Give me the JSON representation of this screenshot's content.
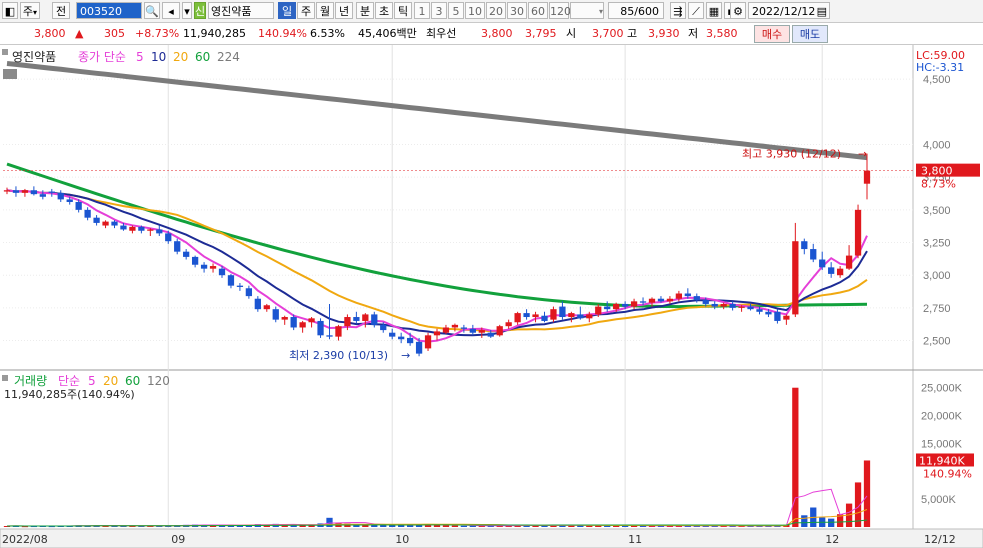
{
  "toolbar": {
    "market": "주",
    "market_arrow": "▾",
    "prev_label": "전",
    "stock_code": "003520",
    "stock_badge": "신",
    "stock_name": "영진약품",
    "periods": [
      "일",
      "주",
      "월",
      "년",
      "분",
      "초",
      "틱"
    ],
    "selected_period": "일",
    "intervals": [
      "1",
      "3",
      "5",
      "10",
      "20",
      "30",
      "60",
      "120"
    ],
    "count": "85/600",
    "date": "2022/12/12"
  },
  "quote": {
    "price": "3,800",
    "arrow": "▲",
    "change": "305",
    "change_pct": "+8.73%",
    "volume": "11,940,285",
    "volume_ratio": "140.94%",
    "turnover": "6.53%",
    "amount": "45,406백만",
    "bid_label": "최우선",
    "ask": "3,800",
    "bid": "3,795",
    "open_label": "시",
    "open": "3,700",
    "high_label": "고",
    "high": "3,930",
    "low_label": "저",
    "low": "3,580",
    "buy_label": "매수",
    "sell_label": "매도"
  },
  "colors": {
    "up": "#e0181d",
    "down": "#1b55d1",
    "ma5": "#e53fd8",
    "ma10": "#1d2b95",
    "ma20": "#f0a810",
    "ma60": "#12a13c",
    "ma224": "#7b7b7b"
  },
  "chart_data": {
    "type": "candlestick",
    "price_panel": {
      "stock_label": "영진약품",
      "legend_prefix": "종가 단순",
      "legend": [
        {
          "name": "5",
          "color": "#e53fd8"
        },
        {
          "name": "10",
          "color": "#1d2b95"
        },
        {
          "name": "20",
          "color": "#f0a810"
        },
        {
          "name": "60",
          "color": "#12a13c"
        },
        {
          "name": "224",
          "color": "#7b7b7b"
        }
      ],
      "lc": "LC:59.00",
      "hc": "HC:-3.31",
      "y_ticks": [
        "4,500",
        "4,000",
        "3,750",
        "3,500",
        "3,250",
        "3,000",
        "2,750",
        "2,500"
      ],
      "y_tick_values": [
        4500,
        4000,
        3750,
        3500,
        3250,
        3000,
        2750,
        2500
      ],
      "ylim": [
        2290,
        4700
      ],
      "current_price": "3,800",
      "current_pct": "8.73%",
      "max_annotation": "최고 3,930 (12/12)",
      "min_annotation": "최저 2,390 (10/13)"
    },
    "volume_panel": {
      "label": "거래량",
      "legend_prefix": "단순",
      "legend": [
        {
          "name": "5",
          "color": "#e53fd8"
        },
        {
          "name": "20",
          "color": "#f0a810"
        },
        {
          "name": "60",
          "color": "#12a13c"
        },
        {
          "name": "120",
          "color": "#7b7b7b"
        }
      ],
      "volume_text": "11,940,285주(140.94%)",
      "y_ticks": [
        "25,000K",
        "20,000K",
        "15,000K",
        "5,000K"
      ],
      "y_tick_values": [
        25000,
        20000,
        15000,
        5000
      ],
      "ylim": [
        0,
        28000
      ],
      "current_volume": "11,940K",
      "current_pct": "140.94%"
    },
    "x_labels": [
      "2022/08",
      "09",
      "10",
      "11",
      "12",
      "12/12"
    ],
    "x_label_index": [
      0,
      18,
      43,
      69,
      91,
      117
    ],
    "candles": [
      [
        3640,
        3670,
        3620,
        3650,
        180
      ],
      [
        3650,
        3680,
        3600,
        3630,
        210
      ],
      [
        3630,
        3660,
        3600,
        3650,
        150
      ],
      [
        3650,
        3680,
        3610,
        3620,
        170
      ],
      [
        3620,
        3650,
        3580,
        3600,
        200
      ],
      [
        3640,
        3660,
        3600,
        3630,
        160
      ],
      [
        3630,
        3650,
        3560,
        3580,
        190
      ],
      [
        3580,
        3600,
        3540,
        3560,
        220
      ],
      [
        3560,
        3580,
        3480,
        3500,
        300
      ],
      [
        3500,
        3520,
        3420,
        3440,
        280
      ],
      [
        3440,
        3460,
        3380,
        3400,
        310
      ],
      [
        3380,
        3420,
        3360,
        3410,
        220
      ],
      [
        3410,
        3420,
        3360,
        3380,
        240
      ],
      [
        3380,
        3400,
        3340,
        3350,
        250
      ],
      [
        3340,
        3380,
        3320,
        3370,
        200
      ],
      [
        3370,
        3380,
        3320,
        3340,
        210
      ],
      [
        3340,
        3360,
        3300,
        3350,
        190
      ],
      [
        3350,
        3380,
        3300,
        3320,
        230
      ],
      [
        3320,
        3340,
        3240,
        3260,
        280
      ],
      [
        3260,
        3280,
        3160,
        3180,
        350
      ],
      [
        3180,
        3200,
        3120,
        3140,
        380
      ],
      [
        3140,
        3150,
        3060,
        3080,
        420
      ],
      [
        3080,
        3100,
        3020,
        3050,
        360
      ],
      [
        3050,
        3090,
        3020,
        3070,
        300
      ],
      [
        3050,
        3070,
        2980,
        3000,
        340
      ],
      [
        3000,
        3010,
        2900,
        2920,
        400
      ],
      [
        2920,
        2940,
        2880,
        2910,
        330
      ],
      [
        2900,
        2920,
        2820,
        2840,
        420
      ],
      [
        2820,
        2840,
        2720,
        2740,
        520
      ],
      [
        2740,
        2780,
        2720,
        2770,
        380
      ],
      [
        2740,
        2760,
        2640,
        2660,
        560
      ],
      [
        2660,
        2690,
        2620,
        2680,
        350
      ],
      [
        2680,
        2700,
        2580,
        2600,
        520
      ],
      [
        2600,
        2650,
        2560,
        2640,
        380
      ],
      [
        2640,
        2680,
        2600,
        2670,
        300
      ],
      [
        2650,
        2670,
        2520,
        2540,
        640
      ],
      [
        2540,
        2780,
        2510,
        2530,
        1650
      ],
      [
        2530,
        2620,
        2500,
        2610,
        750
      ],
      [
        2610,
        2700,
        2580,
        2680,
        620
      ],
      [
        2680,
        2720,
        2630,
        2650,
        400
      ],
      [
        2650,
        2710,
        2600,
        2700,
        500
      ],
      [
        2700,
        2720,
        2600,
        2620,
        420
      ],
      [
        2620,
        2640,
        2560,
        2580,
        380
      ],
      [
        2560,
        2590,
        2510,
        2530,
        300
      ],
      [
        2530,
        2560,
        2480,
        2510,
        280
      ],
      [
        2520,
        2560,
        2460,
        2480,
        320
      ],
      [
        2490,
        2520,
        2380,
        2400,
        480
      ],
      [
        2440,
        2560,
        2420,
        2540,
        520
      ],
      [
        2540,
        2590,
        2500,
        2570,
        380
      ],
      [
        2560,
        2620,
        2550,
        2600,
        300
      ],
      [
        2600,
        2630,
        2570,
        2620,
        250
      ],
      [
        2600,
        2620,
        2560,
        2590,
        220
      ],
      [
        2590,
        2620,
        2540,
        2560,
        240
      ],
      [
        2560,
        2600,
        2520,
        2580,
        200
      ],
      [
        2560,
        2580,
        2520,
        2530,
        230
      ],
      [
        2540,
        2620,
        2530,
        2610,
        260
      ],
      [
        2610,
        2660,
        2590,
        2640,
        280
      ],
      [
        2640,
        2720,
        2620,
        2710,
        320
      ],
      [
        2710,
        2740,
        2660,
        2680,
        260
      ],
      [
        2680,
        2720,
        2640,
        2700,
        220
      ],
      [
        2690,
        2720,
        2640,
        2650,
        240
      ],
      [
        2660,
        2760,
        2640,
        2740,
        340
      ],
      [
        2760,
        2800,
        2660,
        2680,
        380
      ],
      [
        2680,
        2720,
        2640,
        2710,
        260
      ],
      [
        2700,
        2760,
        2660,
        2670,
        280
      ],
      [
        2670,
        2720,
        2640,
        2700,
        240
      ],
      [
        2700,
        2780,
        2680,
        2760,
        330
      ],
      [
        2760,
        2800,
        2720,
        2740,
        280
      ],
      [
        2740,
        2790,
        2720,
        2780,
        250
      ],
      [
        2780,
        2800,
        2740,
        2760,
        230
      ],
      [
        2760,
        2820,
        2740,
        2800,
        260
      ],
      [
        2800,
        2830,
        2770,
        2790,
        210
      ],
      [
        2790,
        2830,
        2760,
        2820,
        230
      ],
      [
        2820,
        2840,
        2790,
        2800,
        200
      ],
      [
        2800,
        2840,
        2780,
        2820,
        210
      ],
      [
        2820,
        2880,
        2800,
        2860,
        250
      ],
      [
        2860,
        2900,
        2820,
        2840,
        230
      ],
      [
        2840,
        2860,
        2790,
        2810,
        200
      ],
      [
        2810,
        2830,
        2760,
        2780,
        230
      ],
      [
        2780,
        2800,
        2740,
        2760,
        210
      ],
      [
        2760,
        2790,
        2740,
        2780,
        190
      ],
      [
        2780,
        2800,
        2730,
        2750,
        200
      ],
      [
        2750,
        2770,
        2720,
        2760,
        180
      ],
      [
        2760,
        2780,
        2730,
        2740,
        190
      ],
      [
        2740,
        2760,
        2700,
        2720,
        220
      ],
      [
        2720,
        2740,
        2680,
        2700,
        200
      ],
      [
        2720,
        2740,
        2630,
        2650,
        350
      ],
      [
        2660,
        2700,
        2620,
        2690,
        380
      ],
      [
        2700,
        3400,
        2680,
        3260,
        25000
      ],
      [
        3260,
        3280,
        3160,
        3200,
        2100
      ],
      [
        3200,
        3240,
        3100,
        3120,
        3500
      ],
      [
        3120,
        3180,
        3040,
        3060,
        1700
      ],
      [
        3060,
        3100,
        2980,
        3010,
        1500
      ],
      [
        3000,
        3070,
        2980,
        3050,
        2300
      ],
      [
        3050,
        3230,
        3040,
        3150,
        4200
      ],
      [
        3150,
        3540,
        3130,
        3500,
        8000
      ],
      [
        3700,
        3930,
        3580,
        3800,
        11940
      ]
    ],
    "ma": {
      "ma5": [
        [
          88,
          2760
        ],
        [
          89,
          2920
        ],
        [
          90,
          3050
        ],
        [
          91,
          3120
        ],
        [
          92,
          3140
        ],
        [
          93,
          3110
        ],
        [
          94,
          3100
        ],
        [
          95,
          3090
        ],
        [
          96,
          3130
        ],
        [
          97,
          3320
        ]
      ],
      "ma10": [
        [
          88,
          2730
        ],
        [
          89,
          2800
        ],
        [
          90,
          2860
        ],
        [
          91,
          2900
        ],
        [
          92,
          2930
        ],
        [
          93,
          2950
        ],
        [
          94,
          2990
        ],
        [
          95,
          3030
        ],
        [
          96,
          3100
        ],
        [
          97,
          3190
        ]
      ],
      "ma20": [
        [
          88,
          2770
        ],
        [
          89,
          2800
        ],
        [
          90,
          2830
        ],
        [
          91,
          2850
        ],
        [
          92,
          2870
        ],
        [
          93,
          2890
        ],
        [
          94,
          2920
        ],
        [
          95,
          2950
        ],
        [
          96,
          2990
        ],
        [
          97,
          3020
        ]
      ],
      "ma60": [
        [
          88,
          2760
        ],
        [
          89,
          2760
        ],
        [
          90,
          2760
        ],
        [
          91,
          2760
        ],
        [
          92,
          2760
        ],
        [
          93,
          2770
        ],
        [
          94,
          2770
        ],
        [
          95,
          2780
        ],
        [
          96,
          2780
        ],
        [
          97,
          2790
        ]
      ],
      "ma224": [
        [
          88,
          3950
        ],
        [
          89,
          3940
        ],
        [
          90,
          3935
        ],
        [
          91,
          3930
        ],
        [
          92,
          3925
        ],
        [
          93,
          3920
        ],
        [
          94,
          3915
        ],
        [
          95,
          3910
        ],
        [
          96,
          3905
        ],
        [
          97,
          3900
        ]
      ]
    }
  }
}
